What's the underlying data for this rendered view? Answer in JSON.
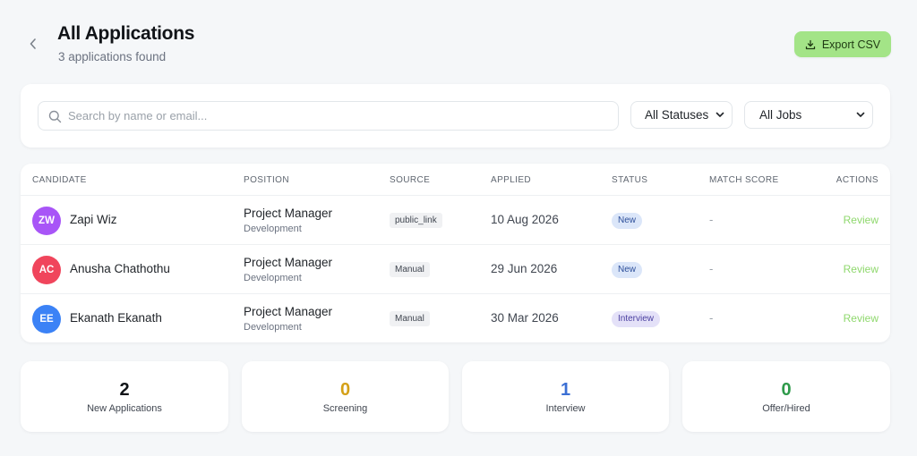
{
  "header": {
    "title": "All Applications",
    "subtitle": "3 applications found",
    "export_label": "Export CSV"
  },
  "filters": {
    "search_placeholder": "Search by name or email...",
    "search_value": "",
    "status_selected": "All Statuses",
    "jobs_selected": "All Jobs"
  },
  "table": {
    "columns": [
      "CANDIDATE",
      "POSITION",
      "SOURCE",
      "APPLIED",
      "STATUS",
      "MATCH SCORE",
      "ACTIONS"
    ],
    "rows": [
      {
        "initials": "ZW",
        "name": "Zapi Wiz",
        "avatar_color": "#a855f7",
        "position": "Project Manager",
        "department": "Development",
        "source": "public_link",
        "applied": "10 Aug 2026",
        "status": "New",
        "match_score": "-",
        "action": "Review"
      },
      {
        "initials": "AC",
        "name": "Anusha Chathothu",
        "avatar_color": "#f0455c",
        "position": "Project Manager",
        "department": "Development",
        "source": "Manual",
        "applied": "29 Jun 2026",
        "status": "New",
        "match_score": "-",
        "action": "Review"
      },
      {
        "initials": "EE",
        "name": "Ekanath Ekanath",
        "avatar_color": "#3b82f6",
        "position": "Project Manager",
        "department": "Development",
        "source": "Manual",
        "applied": "30 Mar 2026",
        "status": "Interview",
        "match_score": "-",
        "action": "Review"
      }
    ]
  },
  "stats": [
    {
      "value": "2",
      "label": "New Applications",
      "color": "#111418"
    },
    {
      "value": "0",
      "label": "Screening",
      "color": "#d4a017"
    },
    {
      "value": "1",
      "label": "Interview",
      "color": "#3b6fd4"
    },
    {
      "value": "0",
      "label": "Offer/Hired",
      "color": "#2e9a4a"
    }
  ],
  "colors": {
    "accent": "#a3e487",
    "review_link": "#8fd86d",
    "status_new_bg": "#dbe6f9",
    "status_interview_bg": "#e4e1f8"
  },
  "icons": {
    "back": "chevron-left-icon",
    "export": "download-icon",
    "search": "search-icon",
    "select": "chevron-down-icon"
  }
}
